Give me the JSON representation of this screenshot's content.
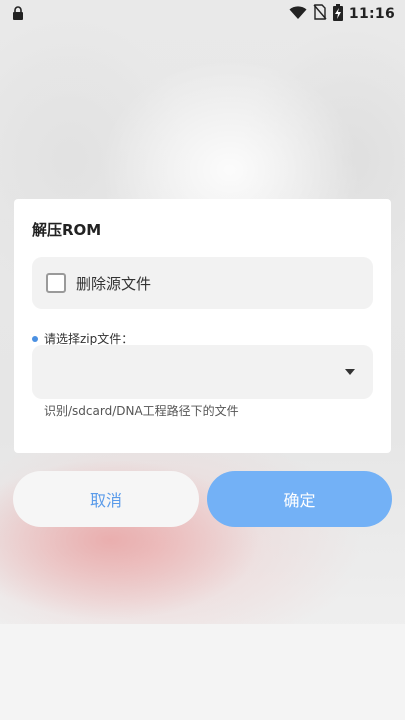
{
  "status_bar": {
    "time": "11:16",
    "icons": [
      "lock-icon",
      "wifi-icon",
      "no-sim-icon",
      "battery-charging-icon"
    ]
  },
  "dialog": {
    "title": "解压ROM",
    "checkbox": {
      "label": "删除源文件",
      "checked": false
    },
    "zip_select": {
      "label": "请选择zip文件：",
      "selected": "",
      "hint": "识别/sdcard/DNA工程路径下的文件"
    }
  },
  "buttons": {
    "cancel": "取消",
    "ok": "确定"
  },
  "colors": {
    "accent": "#73b1f6",
    "cancel_text": "#5a9bea"
  }
}
